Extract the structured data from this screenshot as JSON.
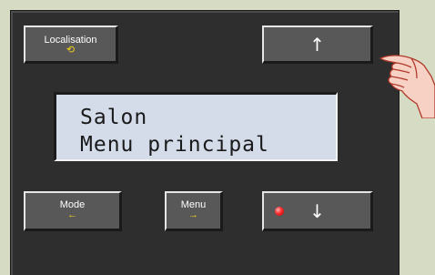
{
  "buttons": {
    "location": {
      "label": "Localisation",
      "symbol": "⟲"
    },
    "up": {
      "symbol": "↑"
    },
    "mode": {
      "label": "Mode",
      "symbol": "←"
    },
    "menu": {
      "label": "Menu",
      "symbol": "→"
    },
    "down": {
      "symbol": "↓",
      "led_color": "#ff2a2a"
    }
  },
  "display": {
    "line1": "Salon",
    "line2": "Menu principal"
  },
  "colors": {
    "background": "#d6dcc4",
    "panel": "#2e2e2e",
    "button": "#585858",
    "accent": "#f2d21a",
    "lcd": "#d4dcea"
  },
  "icons": [
    "rotate-icon",
    "arrow-up-icon",
    "arrow-left-icon",
    "arrow-right-icon",
    "arrow-down-icon",
    "pointing-hand-icon",
    "led-indicator-icon"
  ]
}
